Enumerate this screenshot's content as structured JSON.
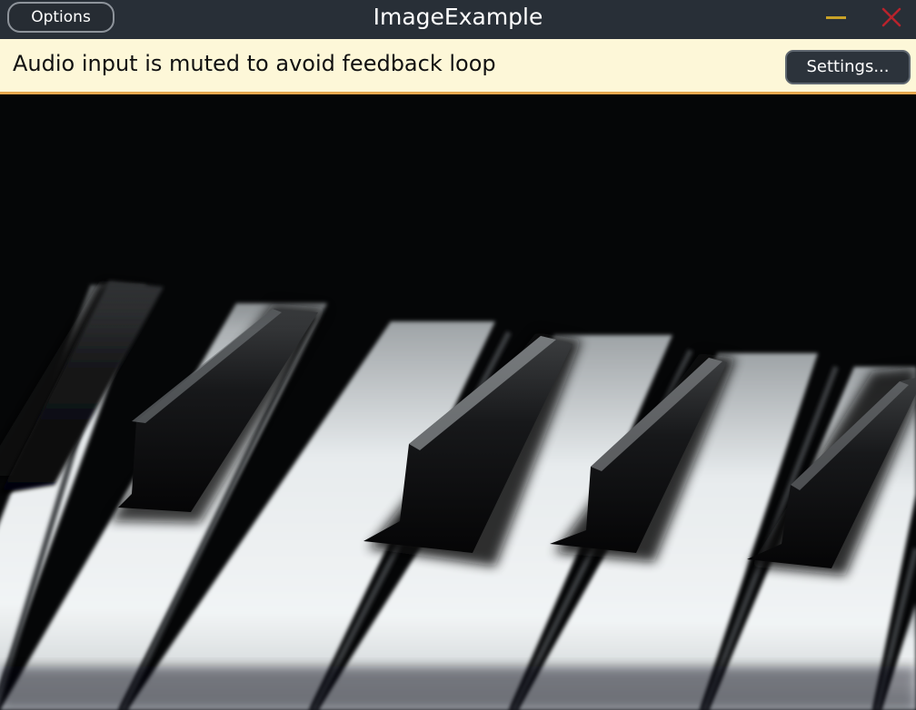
{
  "window": {
    "title": "ImageExample",
    "options_label": "Options",
    "minimize_icon": "minimize-icon",
    "close_icon": "close-icon"
  },
  "notice": {
    "message": "Audio input is muted to avoid feedback loop",
    "settings_label": "Settings..."
  },
  "image": {
    "subject": "piano-keys-photo"
  },
  "colors": {
    "titlebar": "#282f37",
    "notice_background": "#fdf7d8",
    "notice_border": "#e7a84e",
    "minimize": "#c9a227",
    "close": "#b8232c"
  }
}
